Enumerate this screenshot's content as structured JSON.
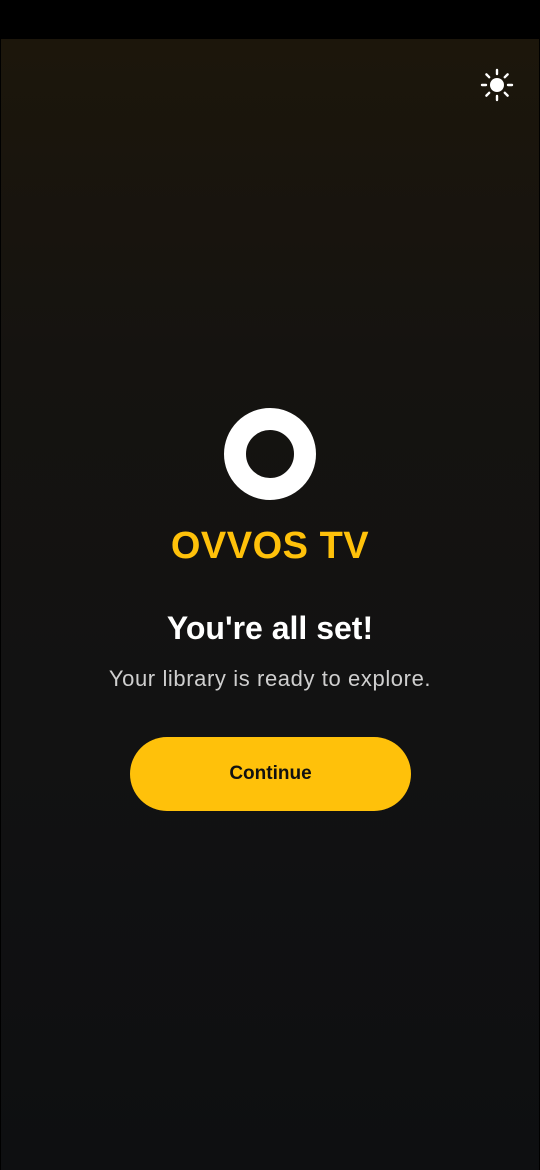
{
  "app": {
    "brand_name": "OVVOS TV",
    "logo_icon": "ring-logo-icon",
    "theme_toggle_icon": "sun-icon"
  },
  "onboarding": {
    "headline": "You're all set!",
    "subtitle": "Your library is ready to explore.",
    "continue_label": "Continue"
  },
  "colors": {
    "accent": "#ffc10a",
    "background_top": "#1c160b",
    "background_bottom": "#0e0f11",
    "headline": "#ffffff",
    "subtitle": "#cfcfcf"
  }
}
